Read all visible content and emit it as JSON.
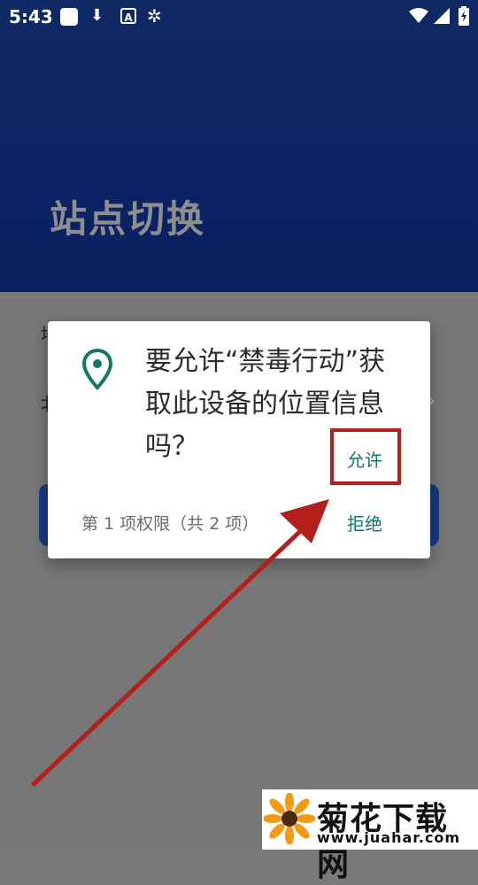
{
  "status_bar": {
    "time": "5:43",
    "left_icons": [
      "square-notification-icon",
      "download-icon",
      "text-a-icon",
      "bug-icon"
    ],
    "right_icons": [
      "wifi-icon",
      "signal-icon",
      "battery-icon"
    ]
  },
  "page": {
    "title": "站点切换",
    "bg_row1_char": "地",
    "bg_row2_char": "北"
  },
  "dialog": {
    "icon": "location-pin-icon",
    "message": "要允许“禁毒行动”获取此设备的位置信息吗？",
    "allow_label": "允许",
    "deny_label": "拒绝",
    "permission_count": "第 1 项权限（共 2 项）"
  },
  "colors": {
    "header_blue": "#0b2466",
    "accent_teal": "#0e7a66",
    "annotation_red": "#b3201b"
  },
  "watermark": {
    "name": "菊花下载网",
    "url": "www.juahar.com"
  }
}
